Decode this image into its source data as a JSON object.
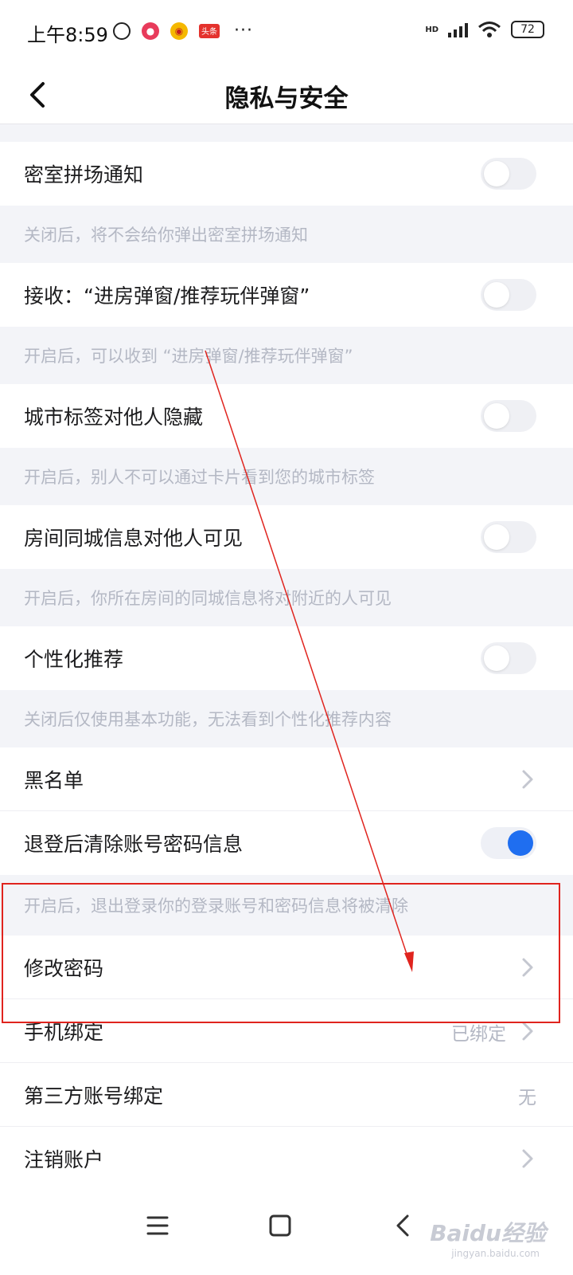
{
  "status_bar": {
    "time": "上午8:59",
    "app_badge_3": "头条",
    "more": "···",
    "network": "HD",
    "battery": "72"
  },
  "header": {
    "title": "隐私与安全"
  },
  "settings": {
    "room_notice": {
      "label": "密室拼场通知",
      "desc": "关闭后，将不会给你弹出密室拼场通知",
      "enabled": false
    },
    "receive_popups": {
      "label": "接收：“进房弹窗/推荐玩伴弹窗”",
      "desc": "开启后，可以收到 “进房弹窗/推荐玩伴弹窗”",
      "enabled": false
    },
    "hide_city": {
      "label": "城市标签对他人隐藏",
      "desc": "开启后，别人不可以通过卡片看到您的城市标签",
      "enabled": false
    },
    "room_city_visible": {
      "label": "房间同城信息对他人可见",
      "desc": "开启后，你所在房间的同城信息将对附近的人可见",
      "enabled": false
    },
    "personalized": {
      "label": "个性化推荐",
      "desc": "关闭后仅使用基本功能，无法看到个性化推荐内容",
      "enabled": false
    },
    "blacklist": {
      "label": "黑名单"
    },
    "clear_on_logout": {
      "label": "退登后清除账号密码信息",
      "desc": "开启后，退出登录你的登录账号和密码信息将被清除",
      "enabled": true
    },
    "change_password": {
      "label": "修改密码"
    },
    "phone_binding": {
      "label": "手机绑定",
      "value": "已绑定"
    },
    "third_party": {
      "label": "第三方账号绑定",
      "value": "无"
    },
    "deactivate": {
      "label": "注销账户"
    }
  },
  "watermark": {
    "text": "Baidu经验",
    "sub": "jingyan.baidu.com"
  },
  "colors": {
    "accent": "#1f6ef0",
    "annotation": "#e0241e"
  }
}
